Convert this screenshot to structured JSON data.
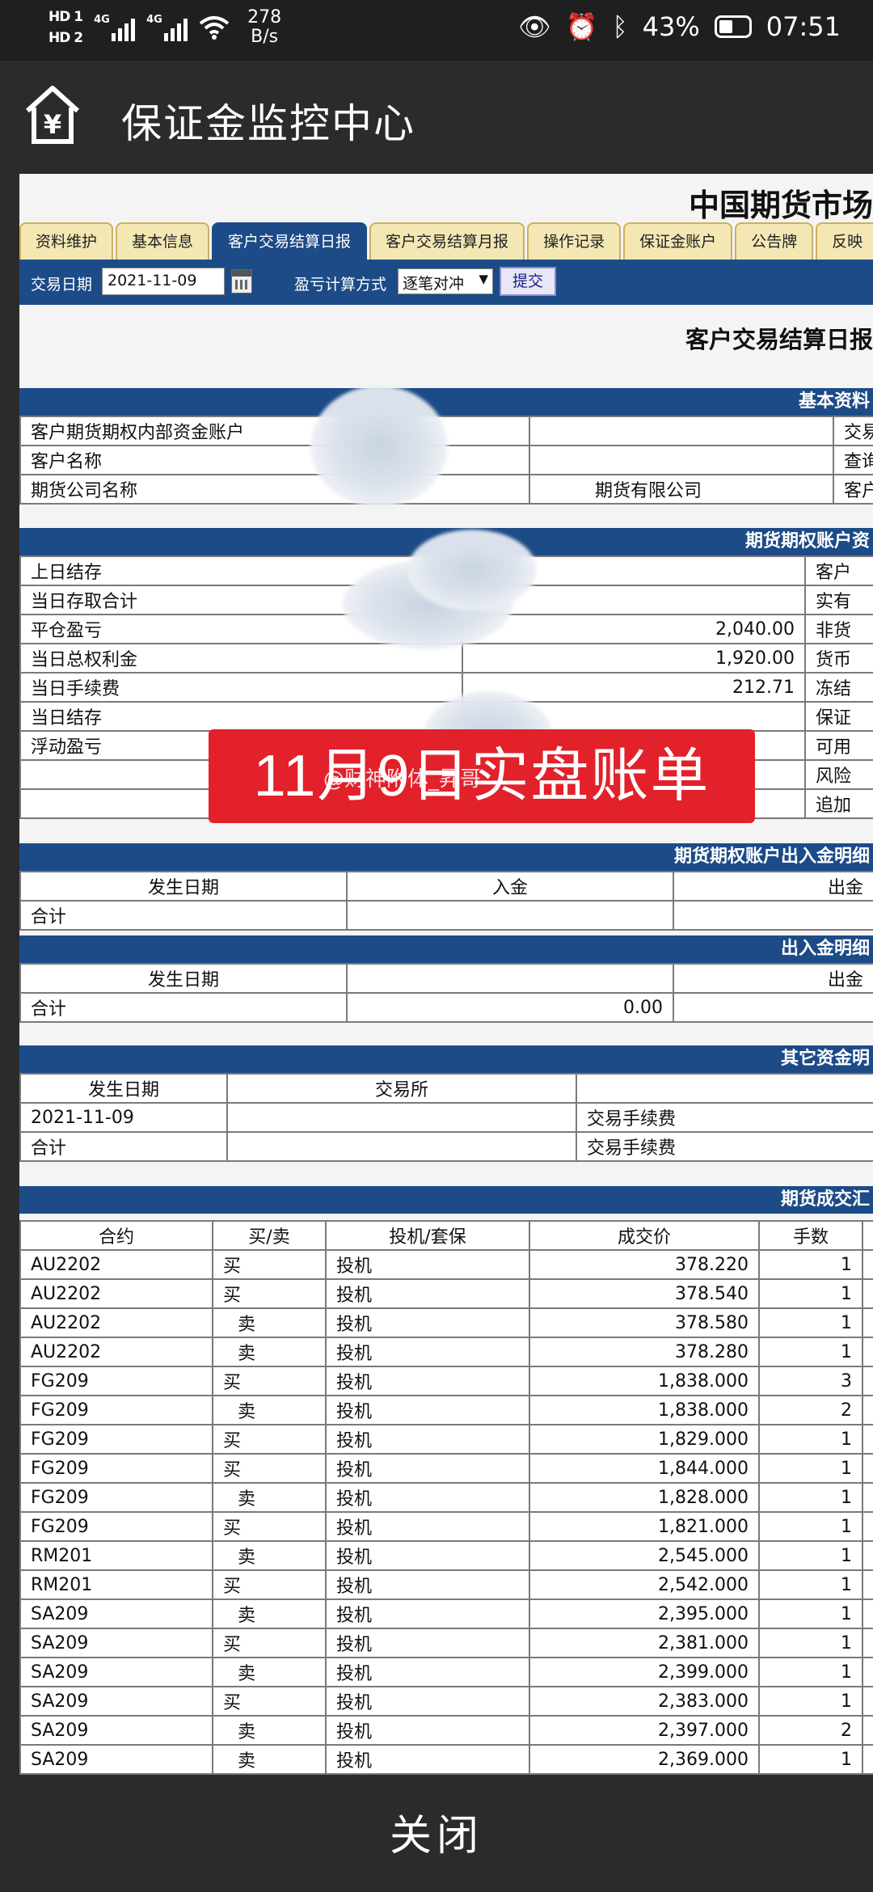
{
  "status_bar": {
    "hd1": "HD 1",
    "hd2": "HD 2",
    "net1": "4G",
    "net2": "4G",
    "speed_value": "278",
    "speed_unit": "B/s",
    "battery_pct": "43%",
    "time": "07:51"
  },
  "header": {
    "title": "保证金监控中心"
  },
  "site_title": "中国期货市场",
  "tabs": [
    {
      "label": "资料维护"
    },
    {
      "label": "基本信息"
    },
    {
      "label": "客户交易结算日报"
    },
    {
      "label": "客户交易结算月报"
    },
    {
      "label": "操作记录"
    },
    {
      "label": "保证金账户"
    },
    {
      "label": "公告牌"
    },
    {
      "label": "反映"
    }
  ],
  "toolbar": {
    "date_label": "交易日期",
    "date_value": "2021-11-09",
    "method_label": "盈亏计算方式",
    "method_value": "逐笔对冲",
    "submit_label": "提交"
  },
  "report_title": "客户交易结算日报",
  "basic_info": {
    "title": "基本资料",
    "rows": [
      {
        "label": "客户期货期权内部资金账户",
        "value": "",
        "right": "交易"
      },
      {
        "label": "客户名称",
        "value": "",
        "right": "查询"
      },
      {
        "label": "期货公司名称",
        "value": "期货有限公司",
        "right": "客户"
      }
    ]
  },
  "account": {
    "title": "期货期权账户资",
    "rows": [
      {
        "label": "上日结存",
        "value": "",
        "right": "客户"
      },
      {
        "label": "当日存取合计",
        "value": "",
        "right": "实有"
      },
      {
        "label": "平仓盈亏",
        "value": "2,040.00",
        "right": "非货"
      },
      {
        "label": "当日总权利金",
        "value": "1,920.00",
        "right": "货币"
      },
      {
        "label": "当日手续费",
        "value": "212.71",
        "right": "冻结"
      },
      {
        "label": "当日结存",
        "value": "",
        "right": "保证"
      },
      {
        "label": "浮动盈亏",
        "value": "",
        "right": "可用"
      },
      {
        "label": "",
        "value": "",
        "right": "风险"
      },
      {
        "label": "",
        "value": "",
        "right": "追加"
      }
    ]
  },
  "inout": {
    "title": "期货期权账户出入金明细",
    "headers": [
      "发生日期",
      "入金",
      "出金"
    ],
    "total_label": "合计"
  },
  "inout2": {
    "title": "出入金明细",
    "headers": [
      "发生日期",
      "",
      "出金"
    ],
    "total_label": "合计",
    "total_value": "0.00"
  },
  "other_funds": {
    "title": "其它资金明",
    "headers": [
      "发生日期",
      "交易所",
      ""
    ],
    "rows": [
      {
        "date": "2021-11-09",
        "exchange": "",
        "type": "交易手续费"
      },
      {
        "date": "合计",
        "exchange": "",
        "type": "交易手续费"
      }
    ]
  },
  "trades": {
    "title": "期货成交汇",
    "headers": [
      "合约",
      "买/卖",
      "投机/套保",
      "成交价",
      "手数"
    ],
    "rows": [
      {
        "contract": "AU2202",
        "side": "买",
        "type": "投机",
        "price": "378.220",
        "lots": "1"
      },
      {
        "contract": "AU2202",
        "side": "买",
        "type": "投机",
        "price": "378.540",
        "lots": "1"
      },
      {
        "contract": "AU2202",
        "side": "卖",
        "type": "投机",
        "price": "378.580",
        "lots": "1"
      },
      {
        "contract": "AU2202",
        "side": "卖",
        "type": "投机",
        "price": "378.280",
        "lots": "1"
      },
      {
        "contract": "FG209",
        "side": "买",
        "type": "投机",
        "price": "1,838.000",
        "lots": "3"
      },
      {
        "contract": "FG209",
        "side": "卖",
        "type": "投机",
        "price": "1,838.000",
        "lots": "2"
      },
      {
        "contract": "FG209",
        "side": "买",
        "type": "投机",
        "price": "1,829.000",
        "lots": "1"
      },
      {
        "contract": "FG209",
        "side": "买",
        "type": "投机",
        "price": "1,844.000",
        "lots": "1"
      },
      {
        "contract": "FG209",
        "side": "卖",
        "type": "投机",
        "price": "1,828.000",
        "lots": "1"
      },
      {
        "contract": "FG209",
        "side": "买",
        "type": "投机",
        "price": "1,821.000",
        "lots": "1"
      },
      {
        "contract": "RM201",
        "side": "卖",
        "type": "投机",
        "price": "2,545.000",
        "lots": "1"
      },
      {
        "contract": "RM201",
        "side": "买",
        "type": "投机",
        "price": "2,542.000",
        "lots": "1"
      },
      {
        "contract": "SA209",
        "side": "卖",
        "type": "投机",
        "price": "2,395.000",
        "lots": "1"
      },
      {
        "contract": "SA209",
        "side": "买",
        "type": "投机",
        "price": "2,381.000",
        "lots": "1"
      },
      {
        "contract": "SA209",
        "side": "卖",
        "type": "投机",
        "price": "2,399.000",
        "lots": "1"
      },
      {
        "contract": "SA209",
        "side": "买",
        "type": "投机",
        "price": "2,383.000",
        "lots": "1"
      },
      {
        "contract": "SA209",
        "side": "卖",
        "type": "投机",
        "price": "2,397.000",
        "lots": "2"
      },
      {
        "contract": "SA209",
        "side": "卖",
        "type": "投机",
        "price": "2,369.000",
        "lots": "1"
      }
    ]
  },
  "watermark": {
    "text": "11月9日实盘账单",
    "handle": "@财神附体_昇哥"
  },
  "close_label": "关闭",
  "colors": {
    "nav_blue": "#1c4b87",
    "tab_yellow": "#f3e7b4",
    "watermark_red": "#e2212b"
  }
}
